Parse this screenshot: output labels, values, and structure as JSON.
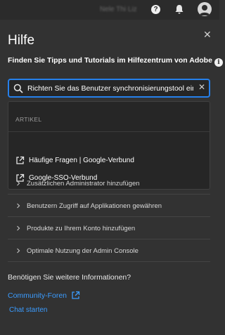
{
  "topbar": {
    "user_name": "Nele Thi Liz",
    "help_icon": "help-circle-icon",
    "bell_icon": "bell-icon",
    "avatar_icon": "avatar-icon"
  },
  "panel": {
    "title": "Hilfe",
    "close_icon": "close-icon",
    "subtitle": "Finden Sie Tipps und Tutorials im Hilfezentrum von Adobe",
    "info_icon": "info-icon"
  },
  "search": {
    "value": "Richten Sie das Benutzer synchronisierungstool ein",
    "search_icon": "search-icon",
    "clear_icon": "clear-icon"
  },
  "dropdown": {
    "heading": "ARTIKEL",
    "articles": [
      {
        "label": "Häufige Fragen | Google-Verbund",
        "icon": "external-link-icon"
      },
      {
        "label": "Google-SSO-Verbund",
        "icon": "external-link-icon"
      }
    ]
  },
  "topics": [
    {
      "label": "Zusätzlichen Administrator hinzufügen"
    },
    {
      "label": "Benutzern Zugriff auf Applikationen gewähren"
    },
    {
      "label": "Produkte zu Ihrem Konto hinzufügen"
    },
    {
      "label": "Optimale Nutzung der Admin Console"
    }
  ],
  "footer": {
    "more_info": "Benötigen Sie weitere Informationen?",
    "community_link": "Community-Foren",
    "chat_link": "Chat starten"
  },
  "colors": {
    "accent": "#2680eb",
    "link": "#3b9cff",
    "background": "#323232"
  }
}
